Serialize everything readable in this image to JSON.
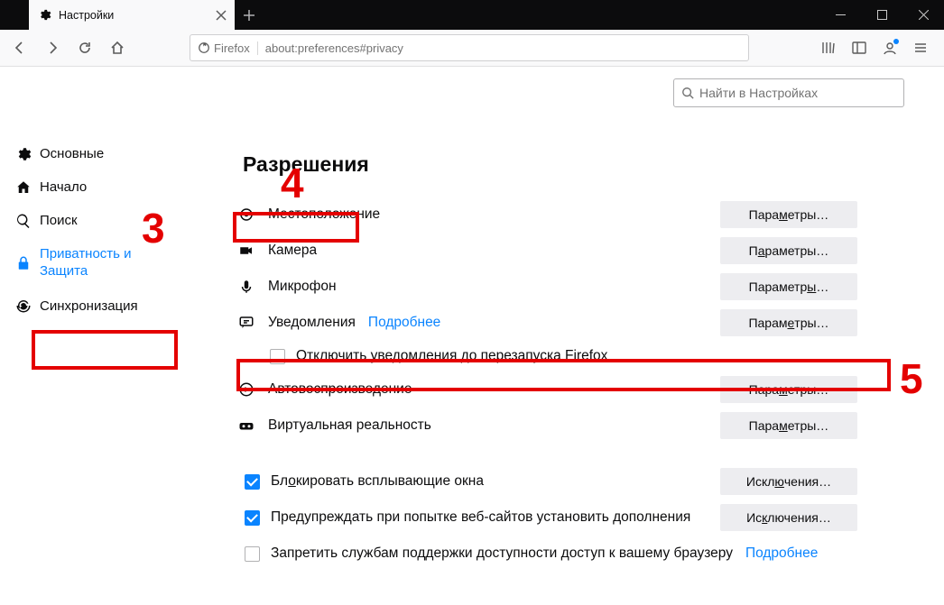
{
  "tab": {
    "title": "Настройки"
  },
  "urlbar": {
    "identity": "Firefox",
    "url": "about:preferences#privacy"
  },
  "search": {
    "placeholder": "Найти в Настройках"
  },
  "sidebar": {
    "items": [
      {
        "label": "Основные"
      },
      {
        "label": "Начало"
      },
      {
        "label": "Поиск"
      },
      {
        "label": "Приватность и Защита"
      },
      {
        "label": "Синхронизация"
      }
    ]
  },
  "section_title": "Разрешения",
  "perms": [
    {
      "label": "Местоположение",
      "btn_pre": "Пара",
      "btn_u": "м",
      "btn_post": "етры…"
    },
    {
      "label": "Камера",
      "btn_pre": "П",
      "btn_u": "а",
      "btn_post": "раметры…"
    },
    {
      "label": "Микрофон",
      "btn_pre": "Параметр",
      "btn_u": "ы",
      "btn_post": "…"
    },
    {
      "label": "Уведомления",
      "link": "Подробнее",
      "btn_pre": "Парам",
      "btn_u": "е",
      "btn_post": "тры…"
    },
    {
      "label": "Автовоспроизведение",
      "btn_pre": "Пара",
      "btn_u": "м",
      "btn_post": "етры…"
    },
    {
      "label": "Виртуальная реальность",
      "btn_pre": "Пара",
      "btn_u": "м",
      "btn_post": "етры…"
    }
  ],
  "notif_pause": "Отключить уведомления до перезапуска Firefox",
  "popups": {
    "label_pre": "Бл",
    "label_u": "о",
    "label_post": "кировать всплывающие окна",
    "btn_pre": "Искл",
    "btn_u": "ю",
    "btn_post": "чения…"
  },
  "addons": {
    "label_pre": "Пре",
    "label_u": "д",
    "label_post": "упреждать при попытке веб-сайтов установить дополнения",
    "btn_pre": "Ис",
    "btn_u": "к",
    "btn_post": "лючения…"
  },
  "a11y": {
    "label": "Запретить службам поддержки доступности доступ к вашему браузеру",
    "link": "Подробнее"
  },
  "annotations": {
    "n3": "3",
    "n4": "4",
    "n5": "5"
  }
}
